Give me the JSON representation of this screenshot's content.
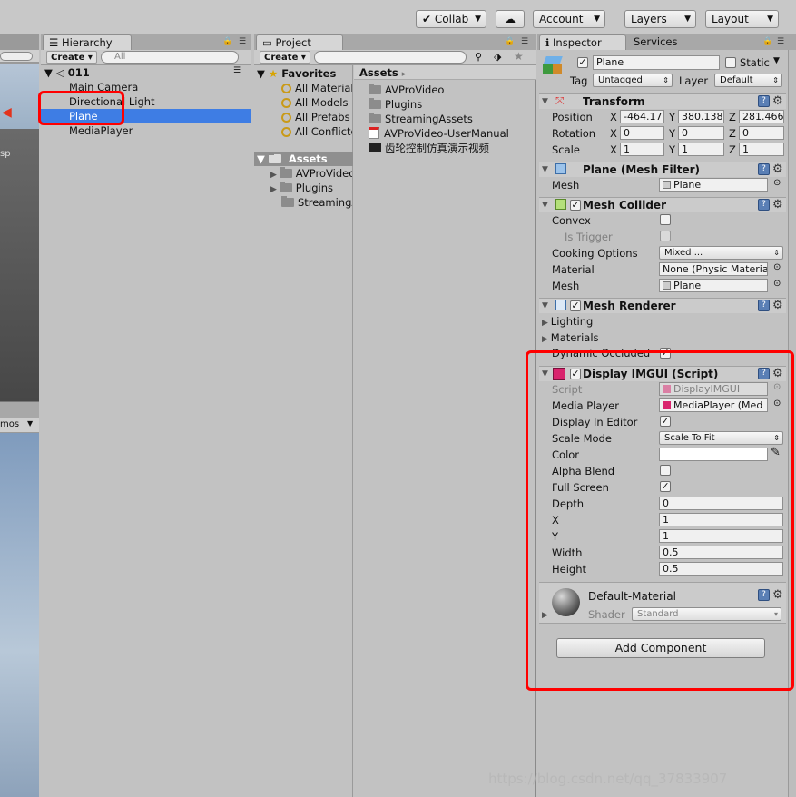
{
  "toolbar": {
    "collab": "Collab",
    "cloud_icon": "cloud-icon",
    "account": "Account",
    "layers": "Layers",
    "layout": "Layout"
  },
  "hierarchy": {
    "tab": "Hierarchy",
    "create": "Create",
    "search_placeholder": "All",
    "scene": "011",
    "items": [
      "Main Camera",
      "Directional Light",
      "Plane",
      "MediaPlayer"
    ],
    "selected": "Plane"
  },
  "project": {
    "tab": "Project",
    "create": "Create",
    "favorites_label": "Favorites",
    "favorites": [
      "All Materials",
      "All Models",
      "All Prefabs",
      "All Conflicted"
    ],
    "assets_label": "Assets",
    "asset_tree": [
      "AVProVideo",
      "Plugins",
      "StreamingAssets"
    ],
    "breadcrumb": "Assets",
    "files": [
      "AVProVideo",
      "Plugins",
      "StreamingAssets",
      "AVProVideo-UserManual",
      "齿轮控制仿真演示视频"
    ]
  },
  "scene_view": {
    "gizmos_partial": "mos",
    "persp_partial": "sp"
  },
  "inspector": {
    "tab": "Inspector",
    "tab2": "Services",
    "object_name": "Plane",
    "static_label": "Static",
    "tag_label": "Tag",
    "tag_value": "Untagged",
    "layer_label": "Layer",
    "layer_value": "Default",
    "transform": {
      "title": "Transform",
      "position_label": "Position",
      "rotation_label": "Rotation",
      "scale_label": "Scale",
      "position": [
        "-464.17",
        "380.138",
        "281.466"
      ],
      "rotation": [
        "0",
        "0",
        "0"
      ],
      "scale": [
        "1",
        "1",
        "1"
      ],
      "axes": [
        "X",
        "Y",
        "Z"
      ]
    },
    "mesh_filter": {
      "title": "Plane (Mesh Filter)",
      "mesh_label": "Mesh",
      "mesh_value": "Plane"
    },
    "mesh_collider": {
      "title": "Mesh Collider",
      "convex_label": "Convex",
      "is_trigger_label": "Is Trigger",
      "cooking_label": "Cooking Options",
      "cooking_value": "Mixed ...",
      "material_label": "Material",
      "material_value": "None (Physic Material)",
      "mesh_label": "Mesh",
      "mesh_value": "Plane"
    },
    "mesh_renderer": {
      "title": "Mesh Renderer",
      "lighting_label": "Lighting",
      "materials_label": "Materials",
      "dynamic_occluded_label": "Dynamic Occluded"
    },
    "display_imgui": {
      "title": "Display IMGUI (Script)",
      "script_label": "Script",
      "script_value": "DisplayIMGUI",
      "media_player_label": "Media Player",
      "media_player_value": "MediaPlayer (Med",
      "display_in_editor_label": "Display In Editor",
      "scale_mode_label": "Scale Mode",
      "scale_mode_value": "Scale To Fit",
      "color_label": "Color",
      "alpha_blend_label": "Alpha Blend",
      "full_screen_label": "Full Screen",
      "depth_label": "Depth",
      "depth_value": "0",
      "x_label": "X",
      "x_value": "1",
      "y_label": "Y",
      "y_value": "1",
      "width_label": "Width",
      "width_value": "0.5",
      "height_label": "Height",
      "height_value": "0.5"
    },
    "material": {
      "name": "Default-Material",
      "shader_label": "Shader",
      "shader_value": "Standard"
    },
    "add_component": "Add Component"
  },
  "watermark": "https://blog.csdn.net/qq_37833907",
  "colors": {
    "selection": "#3e7de4",
    "annotation_red": "#ff0000",
    "scene_sky": "#9db3cc"
  }
}
